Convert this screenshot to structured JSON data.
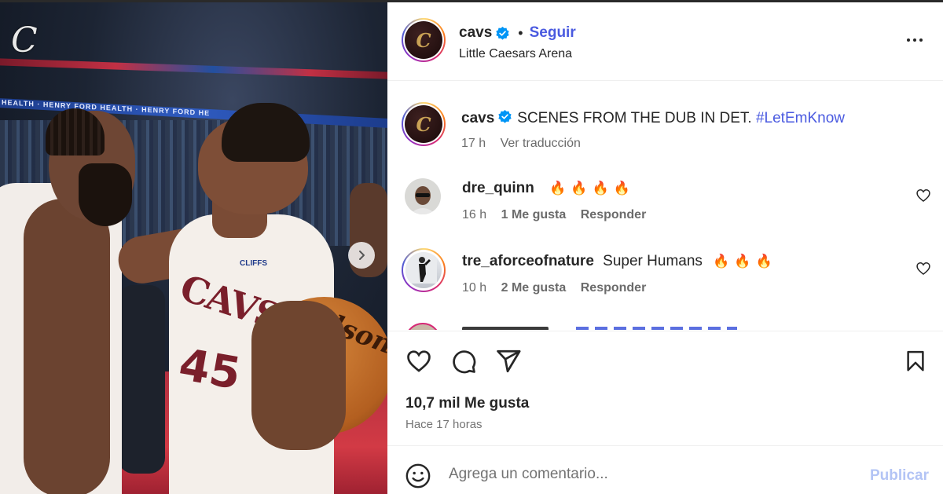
{
  "post": {
    "account": "cavs",
    "follow_label": "Seguir",
    "dot": "•",
    "location": "Little Caesars Arena",
    "photo": {
      "led_text": "HEALTH · HENRY FORD HEALTH · HENRY FORD HE",
      "jersey_text": "CAVS",
      "jersey_number": "45",
      "ball_logo": "Wilson",
      "sponsor": "CLIFFS"
    }
  },
  "caption": {
    "username": "cavs",
    "text": "SCENES FROM THE DUB IN DET.",
    "hashtag": "#LetEmKnow",
    "time": "17 h",
    "translate": "Ver traducción"
  },
  "comments": [
    {
      "username": "dre_quinn",
      "text": "",
      "emoji": "🔥🔥🔥🔥",
      "time": "16 h",
      "likes": "1 Me gusta",
      "reply": "Responder"
    },
    {
      "username": "tre_aforceofnature",
      "text": "Super Humans",
      "emoji": "🔥🔥🔥",
      "time": "10 h",
      "likes": "2 Me gusta",
      "reply": "Responder"
    }
  ],
  "stats": {
    "likes": "10,7 mil Me gusta",
    "time_ago": "Hace 17 horas"
  },
  "add_comment": {
    "placeholder": "Agrega un comentario...",
    "publish": "Publicar"
  },
  "colors": {
    "link_blue": "#4a5ae0",
    "verified_blue": "#0095f6",
    "publish_disabled": "#b3c4f5"
  },
  "icons": [
    "cavs-logo-icon",
    "verified-icon",
    "more-options-icon",
    "heart-icon",
    "comment-icon",
    "share-icon",
    "save-icon",
    "emoji-icon",
    "chevron-right-icon"
  ]
}
